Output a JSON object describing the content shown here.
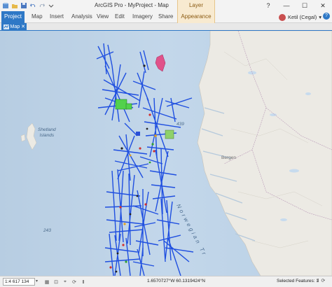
{
  "app": {
    "title": "ArcGIS Pro - MyProject - Map",
    "context_tab_group": "Layer"
  },
  "window_controls": {
    "help": "?",
    "minimize": "—",
    "maximize": "☐",
    "close": "✕"
  },
  "ribbon": {
    "tabs": [
      {
        "label": "Project",
        "active": true
      },
      {
        "label": "Map"
      },
      {
        "label": "Insert"
      },
      {
        "label": "Analysis"
      },
      {
        "label": "View"
      },
      {
        "label": "Edit"
      },
      {
        "label": "Imagery"
      },
      {
        "label": "Share"
      },
      {
        "label": "Appearance"
      }
    ],
    "user": "Ketil (Cegal)"
  },
  "view": {
    "map_tab_label": "Map"
  },
  "map": {
    "labels": {
      "shetland": "Shetland\nIslands",
      "bergen": "Bergen",
      "depth_439": "439",
      "depth_243": "243",
      "sea": "Norwegian Tr"
    }
  },
  "statusbar": {
    "scale": "1:4 617 134",
    "coordinates": "1.6570727°W 60.1319424°N",
    "selected_features": "Selected Features: 1"
  },
  "colors": {
    "accent": "#2e78c6",
    "sea": "#bcd2e6",
    "land": "#eceae4",
    "survey_lines": "#1f4fe0",
    "context_tab": "#f8ead0"
  }
}
